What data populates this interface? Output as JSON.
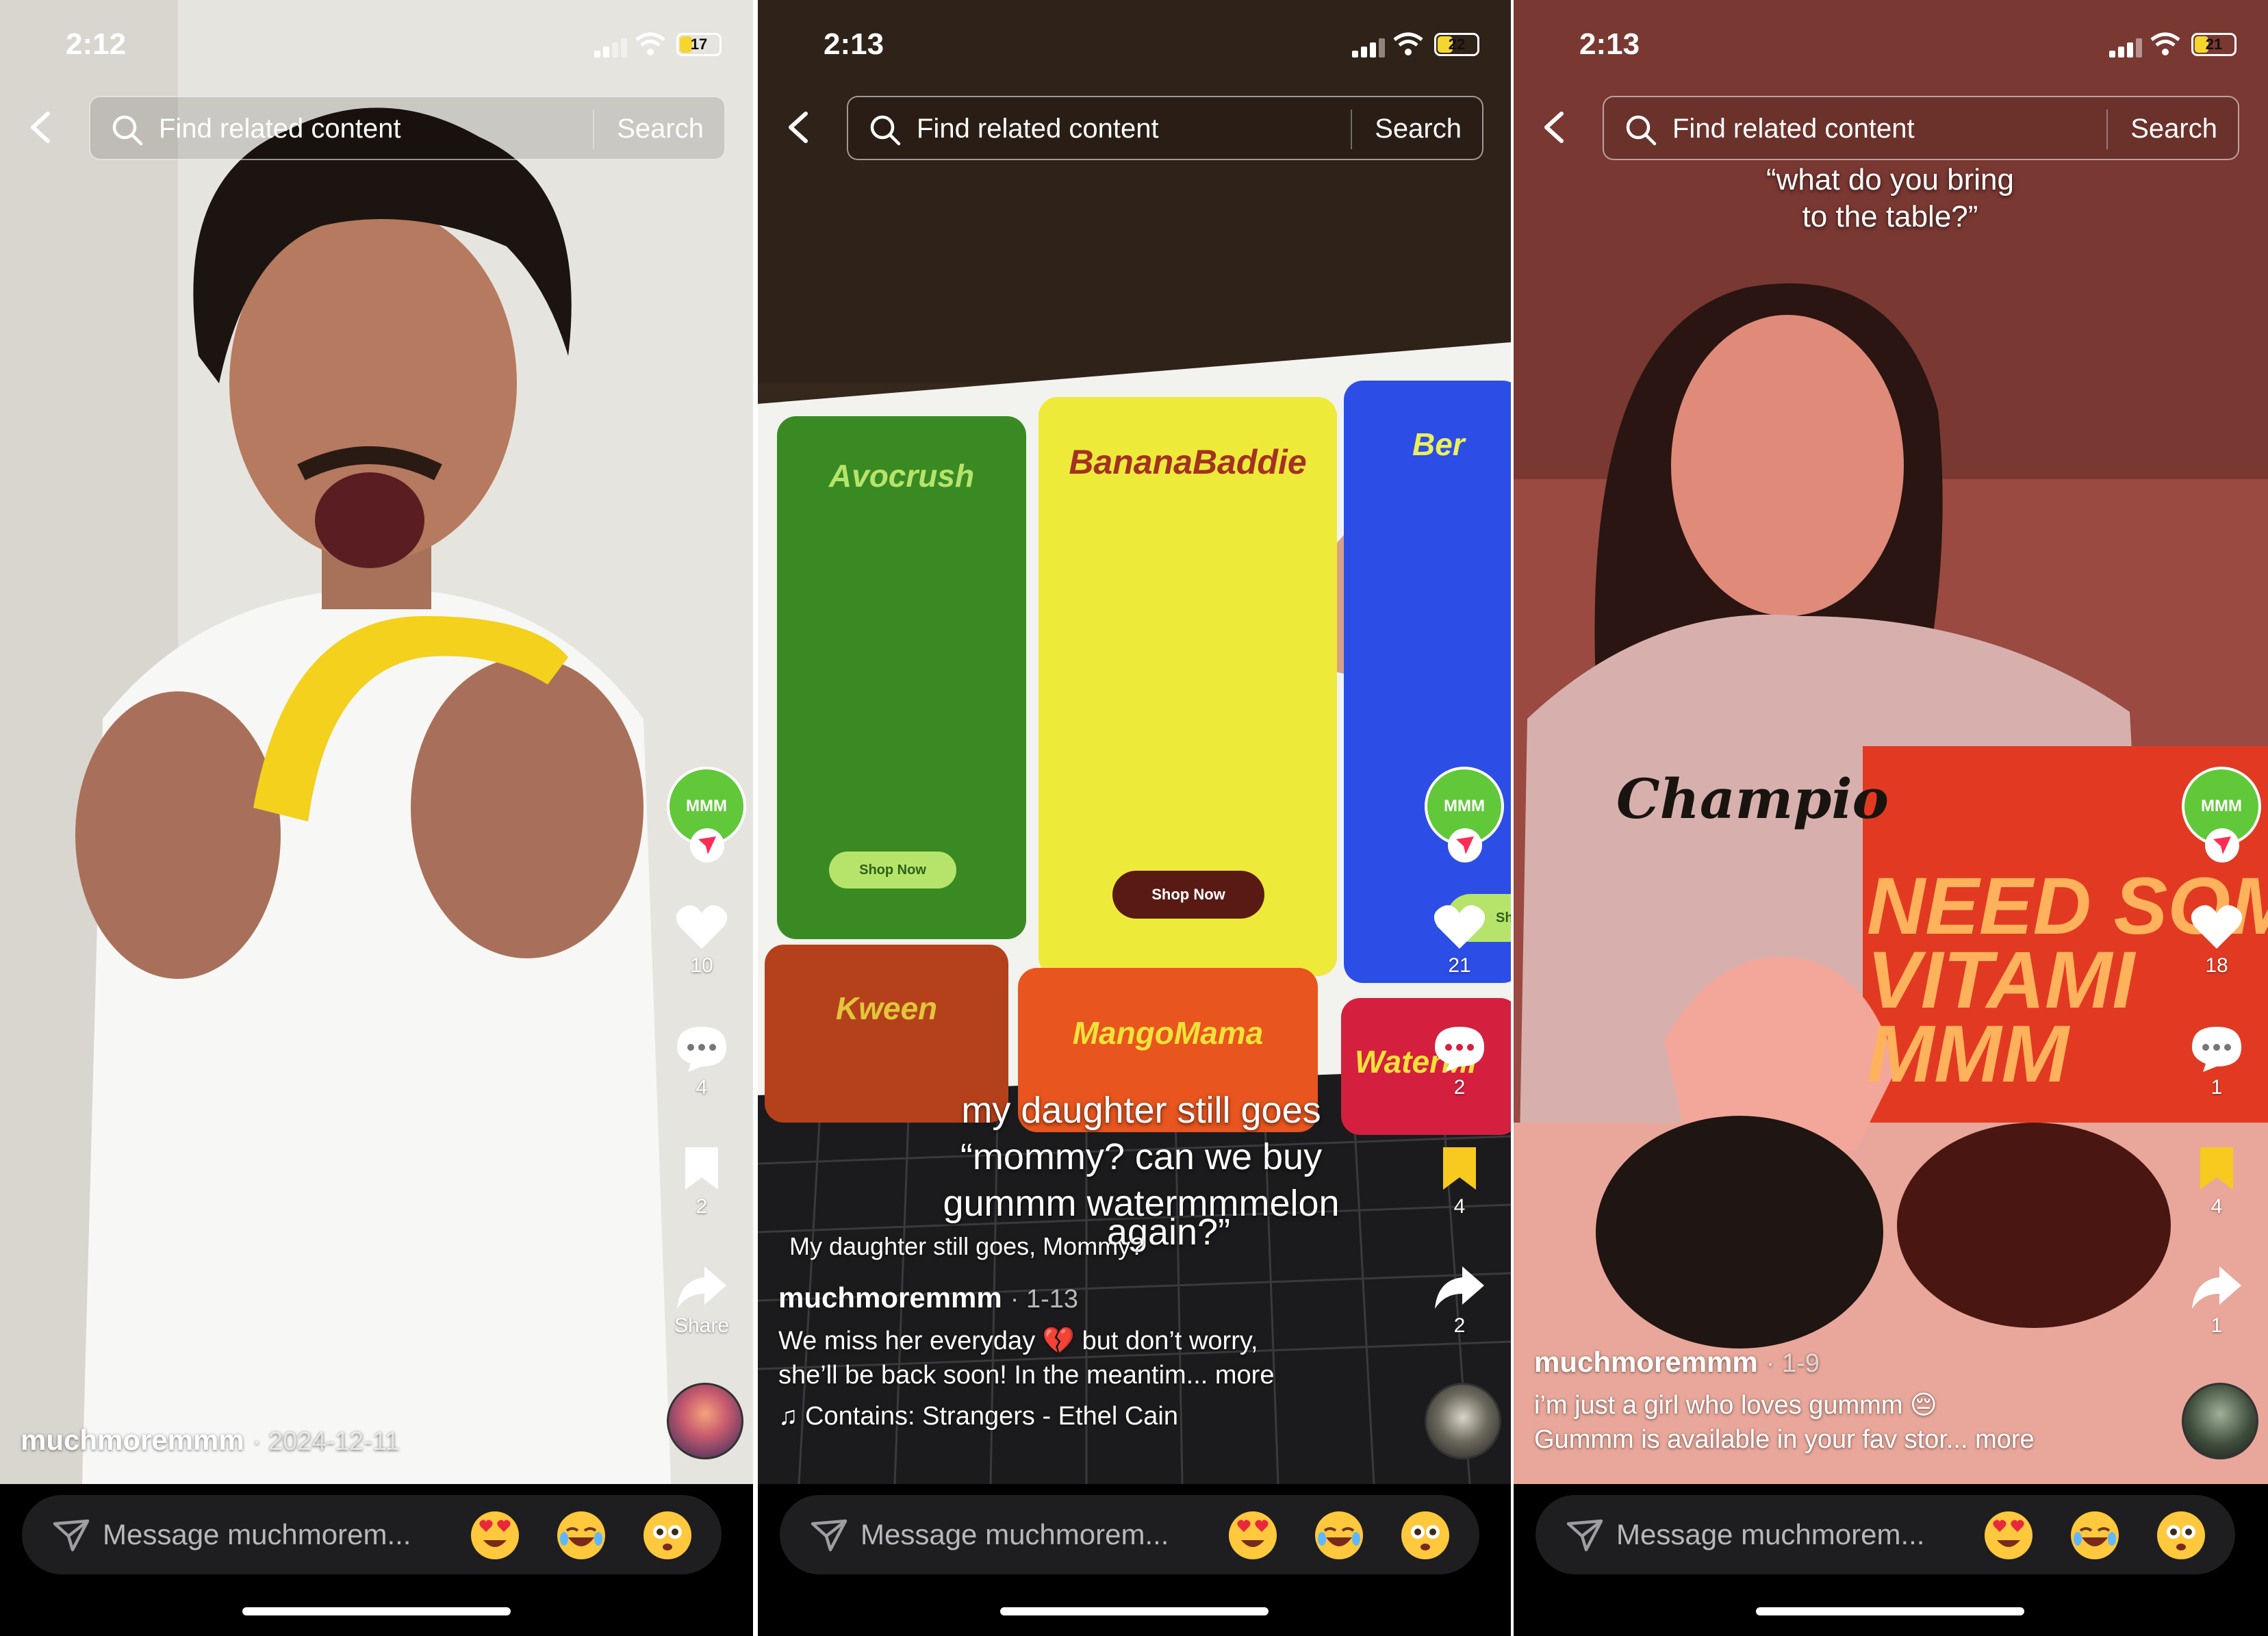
{
  "screens": [
    {
      "status": {
        "time": "2:12",
        "battery": "17"
      },
      "search": {
        "placeholder": "Find related content",
        "button": "Search"
      },
      "rail": {
        "avatar_label": "MMM",
        "likes": "10",
        "comments": "4",
        "saves": "2",
        "share_label": "Share"
      },
      "caption": {
        "username": "muchmoremmm",
        "date": "· 2024-12-11"
      },
      "message": {
        "placeholder": "Message muchmorem..."
      }
    },
    {
      "status": {
        "time": "2:13",
        "battery": "22"
      },
      "search": {
        "placeholder": "Find related content",
        "button": "Search"
      },
      "rail": {
        "avatar_label": "MMM",
        "likes": "21",
        "comments": "2",
        "saves": "4",
        "shares": "2"
      },
      "overlay": {
        "line1": "my daughter still goes",
        "line2": "“mommy? can we buy",
        "line3": "gummm watermmmelon",
        "line4": "again?”"
      },
      "products": {
        "p1": "Avocrush",
        "p2": "BananaBaddie",
        "p3": "Ber",
        "p4": "Kween",
        "p5": "MangoMama",
        "p6": "WaterMl",
        "shop1": "Shop Now",
        "shop2": "Shop Now",
        "shop3": "Sho"
      },
      "caption": {
        "title": "My daughter still goes, Mommy?",
        "username": "muchmoremmm",
        "date": "· 1-13",
        "desc1": "We miss her everyday 💔 but don’t worry,",
        "desc2": "she’ll be back soon! In the meantim... more",
        "music": "♫ Contains: Strangers - Ethel Cain"
      },
      "message": {
        "placeholder": "Message muchmorem..."
      }
    },
    {
      "status": {
        "time": "2:13",
        "battery": "21"
      },
      "search": {
        "placeholder": "Find related content",
        "button": "Search"
      },
      "overlay": {
        "line1": "“what do you bring",
        "line2": "to the table?”"
      },
      "sign": {
        "line1": "NEED SOM",
        "line2": "VITAMI",
        "line3": "MMM"
      },
      "shirt": "Champio",
      "rail": {
        "avatar_label": "MMM",
        "likes": "18",
        "comments": "1",
        "saves": "4",
        "shares": "1"
      },
      "caption": {
        "username": "muchmoremmm",
        "date": "· 1-9",
        "desc1": "i’m just a girl who loves gummm 😔",
        "desc2": "Gummm is available in your fav stor... more"
      },
      "message": {
        "placeholder": "Message muchmorem..."
      }
    }
  ]
}
